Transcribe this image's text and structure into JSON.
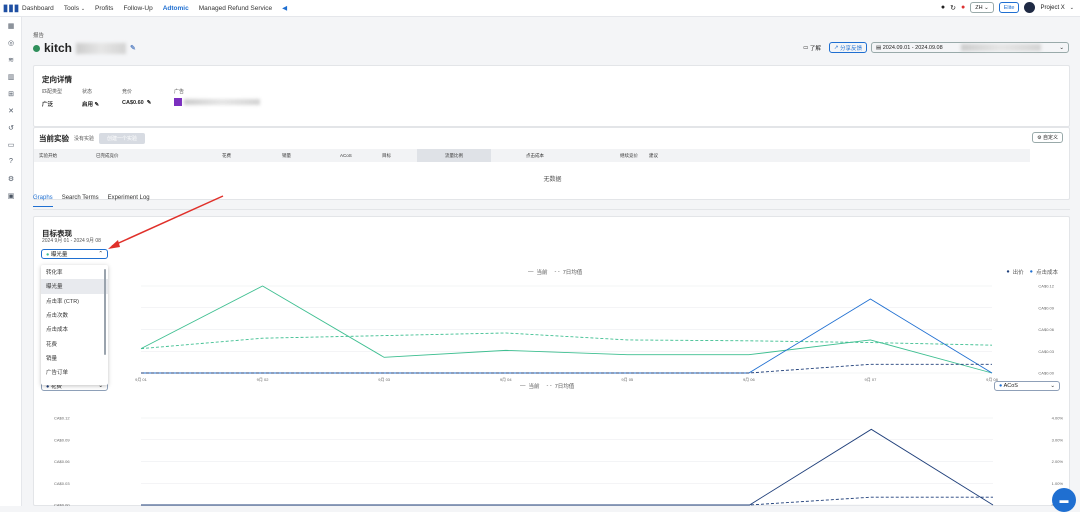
{
  "nav": {
    "items": [
      "Dashboard",
      "Tools",
      "Profits",
      "Follow-Up",
      "Adtomic",
      "Managed Refund Service"
    ],
    "active": "Adtomic"
  },
  "topright": {
    "lang": "ZH",
    "elite": "Elite",
    "project": "Project X"
  },
  "page": {
    "breadcrumb": "报告",
    "title": "kitch",
    "btn_understand": "了解",
    "btn_share": "分享反馈",
    "date_range": "2024.09.01 - 2024.09.08"
  },
  "targeting": {
    "title": "定向详情",
    "cols": [
      "匹配类型",
      "状态",
      "竞价",
      "广告"
    ],
    "values": [
      "广泛",
      "启用",
      "CA$0.60",
      ""
    ]
  },
  "experiment": {
    "title": "当前实验",
    "sub": "没有实验",
    "btn": "创建一个实验",
    "custom": "自定义",
    "cols": [
      "实验开始",
      "已完成竞价",
      "花费",
      "销量",
      "ACoS",
      "目标",
      "流量比例",
      "点击成本",
      "继续竞价",
      "建议"
    ],
    "empty": "无数据"
  },
  "tabs": [
    "Graphs",
    "Search Terms",
    "Experiment Log"
  ],
  "perf": {
    "title": "目标表现",
    "daterange": "2024 9月 01 - 2024 9月 08",
    "selector": "曝光量",
    "legend_current": "当前",
    "legend_avg": "7日均值",
    "legend_a": "出价",
    "legend_b": "点击成本",
    "selector2": "花费",
    "selector3": "ACoS"
  },
  "menu": [
    "转化率",
    "曝光量",
    "点击率 (CTR)",
    "点击次数",
    "点击成本",
    "花费",
    "销量",
    "广告订单"
  ],
  "chart_data": [
    {
      "type": "line",
      "categories": [
        "9月 01",
        "9月 02",
        "9月 03",
        "9月 04",
        "9月 05",
        "9月 06",
        "9月 07",
        "9月 08"
      ],
      "yright": [
        "CA$0.12",
        "CA$0.09",
        "CA$0.06",
        "CA$0.03",
        "CA$0.00"
      ],
      "series": [
        {
          "name": "曝光量",
          "color": "#3fbf91",
          "dash": false,
          "values": [
            0.28,
            1.0,
            0.18,
            0.26,
            0.21,
            0.21,
            0.38,
            0.0
          ]
        },
        {
          "name": "曝光量 7日均值",
          "color": "#3fbf91",
          "dash": true,
          "values": [
            0.28,
            0.4,
            0.43,
            0.46,
            0.38,
            0.37,
            0.35,
            0.32
          ]
        },
        {
          "name": "出价",
          "color": "#1f6fd1",
          "dash": false,
          "values": [
            0.0,
            0.0,
            0.0,
            0.0,
            0.0,
            0.0,
            0.85,
            0.0
          ]
        },
        {
          "name": "出价 7日均值",
          "color": "#1f3f7a",
          "dash": true,
          "values": [
            0.0,
            0.0,
            0.0,
            0.0,
            0.0,
            0.0,
            0.1,
            0.1
          ]
        }
      ]
    },
    {
      "type": "line",
      "categories": [
        "9月 01",
        "9月 02",
        "9月 03",
        "9月 04",
        "9月 05",
        "9月 06",
        "9月 07",
        "9月 08"
      ],
      "yleft": [
        "CA$0.12",
        "CA$0.09",
        "CA$0.06",
        "CA$0.03",
        "CA$0.00"
      ],
      "yright": [
        "4.00%",
        "3.00%",
        "2.00%",
        "1.00%",
        "0.00%"
      ],
      "series": [
        {
          "name": "花费",
          "color": "#1f3f7a",
          "dash": false,
          "values": [
            0.0,
            0.0,
            0.0,
            0.0,
            0.0,
            0.0,
            0.87,
            0.0
          ]
        },
        {
          "name": "花费 7日均值",
          "color": "#1f3f7a",
          "dash": true,
          "values": [
            0.0,
            0.0,
            0.0,
            0.0,
            0.0,
            0.0,
            0.09,
            0.09
          ]
        }
      ]
    }
  ]
}
